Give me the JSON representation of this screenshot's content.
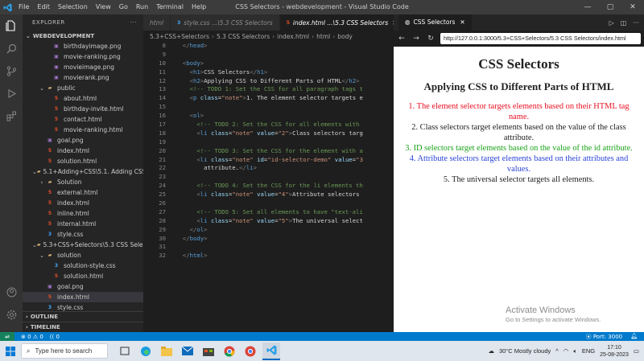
{
  "titlebar": {
    "menu": [
      "File",
      "Edit",
      "Selection",
      "View",
      "Go",
      "Run",
      "Terminal",
      "Help"
    ],
    "title": "CSS Selectors - webdevelopment - Visual Studio Code"
  },
  "explorer": {
    "header": "EXPLORER",
    "root": "WEBDEVELOPMENT",
    "rows": [
      {
        "label": "birthdayimage.png",
        "type": "png",
        "indent": 3
      },
      {
        "label": "movie-ranking.png",
        "type": "png",
        "indent": 3
      },
      {
        "label": "movieimage.png",
        "type": "png",
        "indent": 3
      },
      {
        "label": "movierank.png",
        "type": "png",
        "indent": 3
      },
      {
        "label": "public",
        "type": "folder-open",
        "indent": 2
      },
      {
        "label": "about.html",
        "type": "html",
        "indent": 3
      },
      {
        "label": "birthday-invite.html",
        "type": "html",
        "indent": 3
      },
      {
        "label": "contact.html",
        "type": "html",
        "indent": 3
      },
      {
        "label": "movie-ranking.html",
        "type": "html",
        "indent": 3
      },
      {
        "label": "goal.png",
        "type": "png",
        "indent": 2
      },
      {
        "label": "index.html",
        "type": "html",
        "indent": 2
      },
      {
        "label": "solution.html",
        "type": "html",
        "indent": 2
      },
      {
        "label": "5.1+Adding+CSS\\5.1. Adding CSS",
        "type": "folder-open",
        "indent": 1
      },
      {
        "label": "Solution",
        "type": "folder",
        "indent": 2
      },
      {
        "label": "external.html",
        "type": "html",
        "indent": 2
      },
      {
        "label": "index.html",
        "type": "html",
        "indent": 2
      },
      {
        "label": "inline.html",
        "type": "html",
        "indent": 2
      },
      {
        "label": "internal.html",
        "type": "html",
        "indent": 2
      },
      {
        "label": "style.css",
        "type": "css",
        "indent": 2
      },
      {
        "label": "5.3+CSS+Selectors\\5.3 CSS Sele...",
        "type": "folder-open",
        "indent": 1
      },
      {
        "label": "solution",
        "type": "folder-open",
        "indent": 2
      },
      {
        "label": "solution-style.css",
        "type": "css",
        "indent": 3
      },
      {
        "label": "solution.html",
        "type": "html",
        "indent": 3
      },
      {
        "label": "goal.png",
        "type": "png",
        "indent": 2
      },
      {
        "label": "index.html",
        "type": "html",
        "indent": 2,
        "selected": true
      },
      {
        "label": "style.css",
        "type": "css",
        "indent": 2
      }
    ],
    "outline": "OUTLINE",
    "timeline": "TIMELINE"
  },
  "editor": {
    "tabs": [
      {
        "label": "html",
        "active": false
      },
      {
        "label": "style.css  ...\\5.3 CSS Selectors",
        "active": false
      },
      {
        "label": "index.html  ...\\5.3 CSS Selectors",
        "active": true
      }
    ],
    "breadcrumb": [
      "5.3+CSS+Selectors",
      "5.3 CSS Selectors",
      "index.html",
      "html",
      "body"
    ],
    "lines": [
      {
        "n": "8",
        "html": "  <span class='t-br'>&lt;/</span><span class='t-tag'>head</span><span class='t-br'>&gt;</span>"
      },
      {
        "n": "9",
        "html": ""
      },
      {
        "n": "10",
        "html": "  <span class='t-br'>&lt;</span><span class='t-tag'>body</span><span class='t-br'>&gt;</span>"
      },
      {
        "n": "11",
        "html": "    <span class='t-br'>&lt;</span><span class='t-tag'>h1</span><span class='t-br'>&gt;</span>CSS Selectors<span class='t-br'>&lt;/</span><span class='t-tag'>h1</span><span class='t-br'>&gt;</span>"
      },
      {
        "n": "12",
        "html": "    <span class='t-br'>&lt;</span><span class='t-tag'>h2</span><span class='t-br'>&gt;</span>Applying CSS to Different Parts of HTML<span class='t-br'>&lt;/</span><span class='t-tag'>h2</span><span class='t-br'>&gt;</span>"
      },
      {
        "n": "13",
        "html": "    <span class='t-com'>&lt;!-- TODO 1: Set the CSS for all paragraph tags t</span>"
      },
      {
        "n": "14",
        "html": "    <span class='t-br'>&lt;</span><span class='t-tag'>p</span> <span class='t-attr'>class</span>=<span class='t-val'>\"note\"</span><span class='t-br'>&gt;</span>1. The element selector targets e"
      },
      {
        "n": "15",
        "html": ""
      },
      {
        "n": "16",
        "html": "    <span class='t-br'>&lt;</span><span class='t-tag'>ol</span><span class='t-br'>&gt;</span>"
      },
      {
        "n": "17",
        "html": "      <span class='t-com'>&lt;!-- TODO 2: Set the CSS for all elements with</span>"
      },
      {
        "n": "18",
        "html": "      <span class='t-br'>&lt;</span><span class='t-tag'>li</span> <span class='t-attr'>class</span>=<span class='t-val'>\"note\"</span> <span class='t-attr'>value</span>=<span class='t-val'>\"2\"</span><span class='t-br'>&gt;</span>Class selectors targ"
      },
      {
        "n": "19",
        "html": ""
      },
      {
        "n": "20",
        "html": "      <span class='t-com'>&lt;!-- TODO 3: Set the CSS for the element with a</span>"
      },
      {
        "n": "21",
        "html": "      <span class='t-br'>&lt;</span><span class='t-tag'>li</span> <span class='t-attr'>class</span>=<span class='t-val'>\"note\"</span> <span class='t-attr'>id</span>=<span class='t-val'>\"id-selector-demo\"</span> <span class='t-attr'>value</span>=<span class='t-val'>\"3</span>"
      },
      {
        "n": "22",
        "html": "        attribute.<span class='t-br'>&lt;/</span><span class='t-tag'>li</span><span class='t-br'>&gt;</span>"
      },
      {
        "n": "23",
        "html": ""
      },
      {
        "n": "24",
        "html": "      <span class='t-com'>&lt;!-- TODO 4: Set the CSS for the li elements th</span>"
      },
      {
        "n": "25",
        "html": "      <span class='t-br'>&lt;</span><span class='t-tag'>li</span> <span class='t-attr'>class</span>=<span class='t-val'>\"note\"</span> <span class='t-attr'>value</span>=<span class='t-val'>\"4\"</span><span class='t-br'>&gt;</span>Attribute selectors "
      },
      {
        "n": "26",
        "html": ""
      },
      {
        "n": "27",
        "html": "      <span class='t-com'>&lt;!-- TODO 5: Set all elements to have \"text-ali</span>"
      },
      {
        "n": "28",
        "html": "      <span class='t-br'>&lt;</span><span class='t-tag'>li</span> <span class='t-attr'>class</span>=<span class='t-val'>\"note\"</span> <span class='t-attr'>value</span>=<span class='t-val'>\"5\"</span><span class='t-br'>&gt;</span>The universal select"
      },
      {
        "n": "29",
        "html": "    <span class='t-br'>&lt;/</span><span class='t-tag'>ol</span><span class='t-br'>&gt;</span>"
      },
      {
        "n": "30",
        "html": "  <span class='t-br'>&lt;/</span><span class='t-tag'>body</span><span class='t-br'>&gt;</span>"
      },
      {
        "n": "31",
        "html": ""
      },
      {
        "n": "32",
        "html": "  <span class='t-br'>&lt;/</span><span class='t-tag'>html</span><span class='t-br'>&gt;</span>"
      }
    ]
  },
  "browser": {
    "tab_title": "CSS Selectors",
    "url": "http://127.0.0.1:3000/5.3+CSS+Selectors/5.3 CSS Selectors/index.html",
    "h1": "CSS Selectors",
    "h2": "Applying CSS to Different Parts of HTML",
    "items": [
      {
        "text": "1. The element selector targets elements based on their HTML tag name.",
        "color": "#e81123"
      },
      {
        "text": "2. Class selectors target elements based on the value of the class attribute.",
        "color": "#222222"
      },
      {
        "text": "3. ID selectors target elements based on the value of the id attribute.",
        "color": "#1aa31a"
      },
      {
        "text": "4. Attribute selectors target elements based on their attributes and values.",
        "color": "#2b44d8"
      },
      {
        "text": "5. The universal selector targets all elements.",
        "color": "#222222"
      }
    ],
    "watermark_title": "Activate Windows",
    "watermark_sub": "Go to Settings to activate Windows."
  },
  "statusbar": {
    "errors": "0",
    "warnings": "0",
    "remote": "(( 0",
    "port": "Port: 3000"
  },
  "taskbar": {
    "search_placeholder": "Type here to search",
    "weather": "30°C  Mostly cloudy",
    "lang": "ENG",
    "time": "17:10",
    "date": "25-08-2023"
  },
  "colors": {
    "accent": "#007acc",
    "html_icon": "#e44d26",
    "css_icon": "#42a5f5"
  }
}
